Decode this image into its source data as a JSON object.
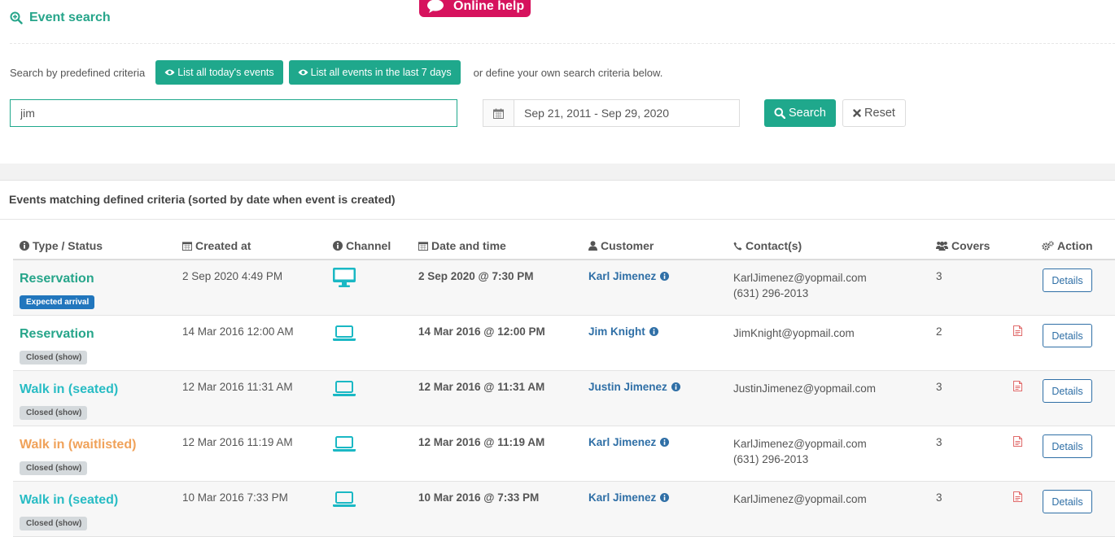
{
  "help": {
    "label": "Online help",
    "icon": "speech-bubble-icon"
  },
  "header": {
    "title": "Event search",
    "icon": "search-plus-icon"
  },
  "predefined": {
    "label": "Search by predefined criteria",
    "today_button": "List all today's events",
    "week_button": "List all events in the last 7 days",
    "or_text": "or define your own search criteria below."
  },
  "search": {
    "value": "jim",
    "date_range": "Sep 21, 2011 - Sep 29, 2020",
    "search_button": "Search",
    "reset_button": "Reset"
  },
  "results": {
    "title": "Events matching defined criteria (sorted by date when event is created)",
    "columns": {
      "type_status": "Type / Status",
      "created_at": "Created at",
      "channel": "Channel",
      "date_time": "Date and time",
      "customer": "Customer",
      "contacts": "Contact(s)",
      "covers": "Covers",
      "action": "Action"
    },
    "rows": [
      {
        "type": "Reservation",
        "status": "Expected arrival",
        "created": "2 Sep 2020 4:49 PM",
        "channel_icon": "desktop-icon",
        "datetime": "2 Sep 2020 @ 7:30 PM",
        "customer": "Karl Jimenez",
        "email": "KarlJimenez@yopmail.com",
        "phone": "(631) 296-2013",
        "covers": "3",
        "details": "Details"
      },
      {
        "type": "Reservation",
        "status": "Closed (show)",
        "created": "14 Mar 2016 12:00 AM",
        "channel_icon": "laptop-icon",
        "datetime": "14 Mar 2016 @ 12:00 PM",
        "customer": "Jim Knight",
        "email": "JimKnight@yopmail.com",
        "phone": "",
        "covers": "2",
        "details": "Details"
      },
      {
        "type": "Walk in (seated)",
        "status": "Closed (show)",
        "created": "12 Mar 2016 11:31 AM",
        "channel_icon": "laptop-icon",
        "datetime": "12 Mar 2016 @ 11:31 AM",
        "customer": "Justin Jimenez",
        "email": "JustinJimenez@yopmail.com",
        "phone": "",
        "covers": "3",
        "details": "Details"
      },
      {
        "type": "Walk in (waitlisted)",
        "status": "Closed (show)",
        "created": "12 Mar 2016 11:19 AM",
        "channel_icon": "laptop-icon",
        "datetime": "12 Mar 2016 @ 11:19 AM",
        "customer": "Karl Jimenez",
        "email": "KarlJimenez@yopmail.com",
        "phone": "(631) 296-2013",
        "covers": "3",
        "details": "Details"
      },
      {
        "type": "Walk in (seated)",
        "status": "Closed (show)",
        "created": "10 Mar 2016 7:33 PM",
        "channel_icon": "laptop-icon",
        "datetime": "10 Mar 2016 @ 7:33 PM",
        "customer": "Karl Jimenez",
        "email": "KarlJimenez@yopmail.com",
        "phone": "",
        "covers": "3",
        "details": "Details"
      }
    ]
  },
  "colors": {
    "accent": "#1fa88c",
    "link": "#2f6fa6",
    "help_badge": "#d6125d",
    "reservation": "#26a58a",
    "walk_in_seated": "#28bcc4",
    "walk_in_waitlisted": "#f0a25a",
    "expected_badge": "#2176bd",
    "closed_badge": "#d4d9dc",
    "pdf": "#e06a6a"
  }
}
